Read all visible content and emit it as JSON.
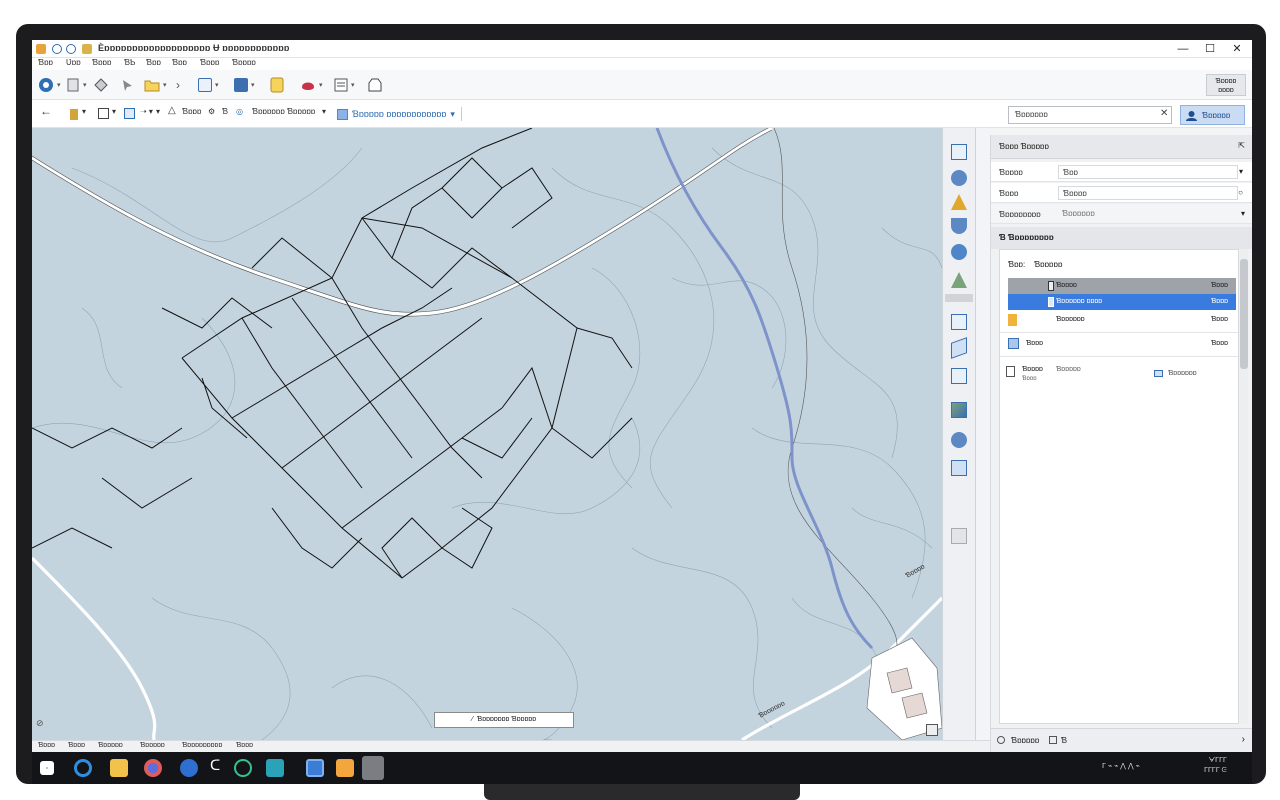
{
  "window": {
    "title": "Ѐɒɒɒɒɒɒɒɒɒɒɒɒɒɒɒɒɒɒɒ Ʉ ɒɒɒɒɒɒɒɒɒɒɒɒ",
    "minimize": "—",
    "maximize": "☐",
    "close": "✕"
  },
  "menu": [
    "Ɓɒɒ",
    "Ʋɒɒ",
    "Ɓɒɒɒ",
    "ƁƄ",
    "Ɓɒɒ",
    "Ɓɒɒ",
    "Ɓɒɒɒ",
    "Ɓɒɒɒɒ"
  ],
  "ribbon": {
    "account_label": "Ɓɒɒɒɒ\nɒɒɒɒ"
  },
  "toolbar2": {
    "back": "←",
    "items": [
      "Ɓɒɒɒ",
      "Ɓ",
      "Ɓɒɒɒɒɒɒ Ɓɒɒɒɒɒ"
    ],
    "selected_layer": "Ɓɒɒɒɒɒ ɒɒɒɒɒɒɒɒɒɒɒɒ"
  },
  "search": {
    "placeholder": "Ɓɒɒɒɒɒɒ",
    "clear": "✕",
    "sign_in": "Ɓɒɒɒɒɒ"
  },
  "map": {
    "scale_text": "Ɓɒɒɒɒɒɒɒ Ɓɒɒɒɒɒ",
    "scale_prefix": "⁄",
    "corner_label": "⊘"
  },
  "panel": {
    "title": "Ɓɒɒɒ Ɓɒɒɒɒɒ",
    "pin": "⇱",
    "rows": [
      {
        "k": "Ɓɒɒɒɒ",
        "v": "Ɓɒɒ"
      },
      {
        "k": "Ɓɒɒɒ",
        "v": "Ɓɒɒɒɒ"
      },
      {
        "k": "Ɓɒɒɒɒɒɒɒɒ",
        "v": "Ɓɒɒɒɒɒɒ"
      }
    ],
    "section_title": "Ɓ    Ɓɒɒɒɒɒɒɒɒ",
    "list_header": {
      "k": "Ɓɒɒ:",
      "v": "Ɓɒɒɒɒɒ"
    },
    "layers": [
      {
        "name": "Ɓɒɒɒɒ",
        "num": "Ɓɒɒɒ",
        "state": "hover"
      },
      {
        "name": "Ɓɒɒɒɒɒɒ ɒɒɒɒ",
        "num": "Ɓɒɒɒ",
        "state": "selected"
      },
      {
        "name": "Ɓɒɒɒɒɒɒ",
        "num": "Ɓɒɒɒ",
        "state": "normal"
      },
      {
        "name": "Ɓɒɒɒ",
        "num": "Ɓɒɒɒ",
        "state": "normal"
      }
    ],
    "extra_item": {
      "name": "Ɓɒɒɒɒ",
      "sub": "Ɓɒɒɒ",
      "desc": "Ɓɒɒɒɒɒ",
      "badge": "Ɓɒɒɒɒɒɒ"
    },
    "footer": {
      "left": "Ɓɒɒɒɒɒ",
      "mid": "Ɓ",
      "arrow": "›"
    }
  },
  "statusbar": [
    "Ɓɒɒɒ",
    "Ɓɒɒɒ",
    "Ɓɒɒɒɒɒ",
    "Ɓɒɒɒɒɒ",
    "Ɓɒɒɒɒɒɒɒɒɒ",
    "Ɓɒɒɒ"
  ],
  "taskbar": {
    "tray": "ᒥ ⌁ ⌁ ⋀ ⋀ ⌁",
    "time": "ᗄᒥᒥᒥ",
    "date": "ᒥᒥᒥᒥ  ᕮ"
  },
  "colors": {
    "map_fill": "#c4d4df",
    "road": "#ffffff",
    "river": "#7e93c9",
    "parcel_line": "#111111",
    "contour": "#7c96a8",
    "selection": "#3a7be0"
  }
}
